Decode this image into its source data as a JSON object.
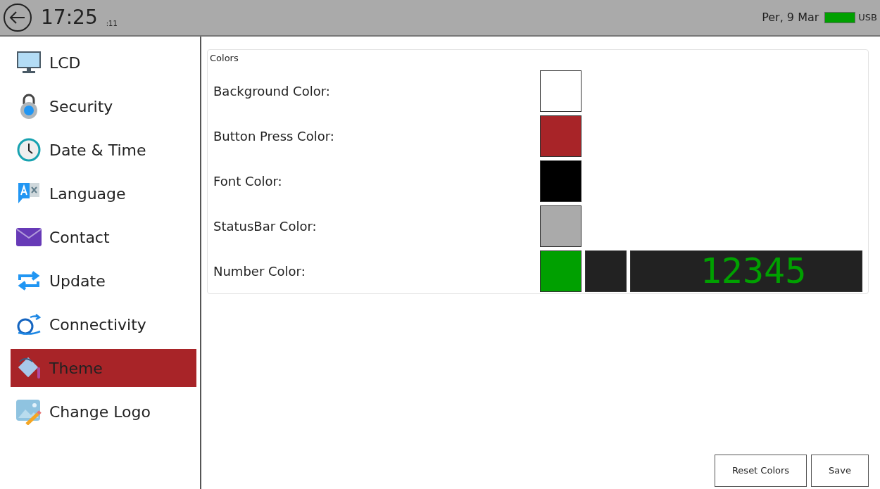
{
  "status_bar": {
    "time": "17:25",
    "seconds": ":11",
    "date": "Per, 9 Mar",
    "usb": "USB"
  },
  "sidebar": {
    "items": [
      {
        "label": "LCD",
        "selected": false
      },
      {
        "label": "Security",
        "selected": false
      },
      {
        "label": "Date & Time",
        "selected": false
      },
      {
        "label": "Language",
        "selected": false
      },
      {
        "label": "Contact",
        "selected": false
      },
      {
        "label": "Update",
        "selected": false
      },
      {
        "label": "Connectivity",
        "selected": false
      },
      {
        "label": "Theme",
        "selected": true
      },
      {
        "label": "Change Logo",
        "selected": false
      }
    ]
  },
  "colors": {
    "title": "Colors",
    "rows": [
      {
        "kind": "swatch",
        "label": "Background Color:",
        "color": "#ffffff"
      },
      {
        "kind": "swatch",
        "label": "Button Press Color:",
        "color": "#a82428"
      },
      {
        "kind": "swatch",
        "label": "Font Color:",
        "color": "#000000"
      },
      {
        "kind": "swatch",
        "label": "StatusBar Color:",
        "color": "#aaaaaa"
      },
      {
        "kind": "number",
        "label": "Number Color:",
        "color": "#00a000",
        "extra_swatches": [
          {
            "color": "#222222"
          }
        ],
        "sample": "12345"
      }
    ]
  },
  "buttons": [
    "Reset Colors",
    "Save"
  ]
}
